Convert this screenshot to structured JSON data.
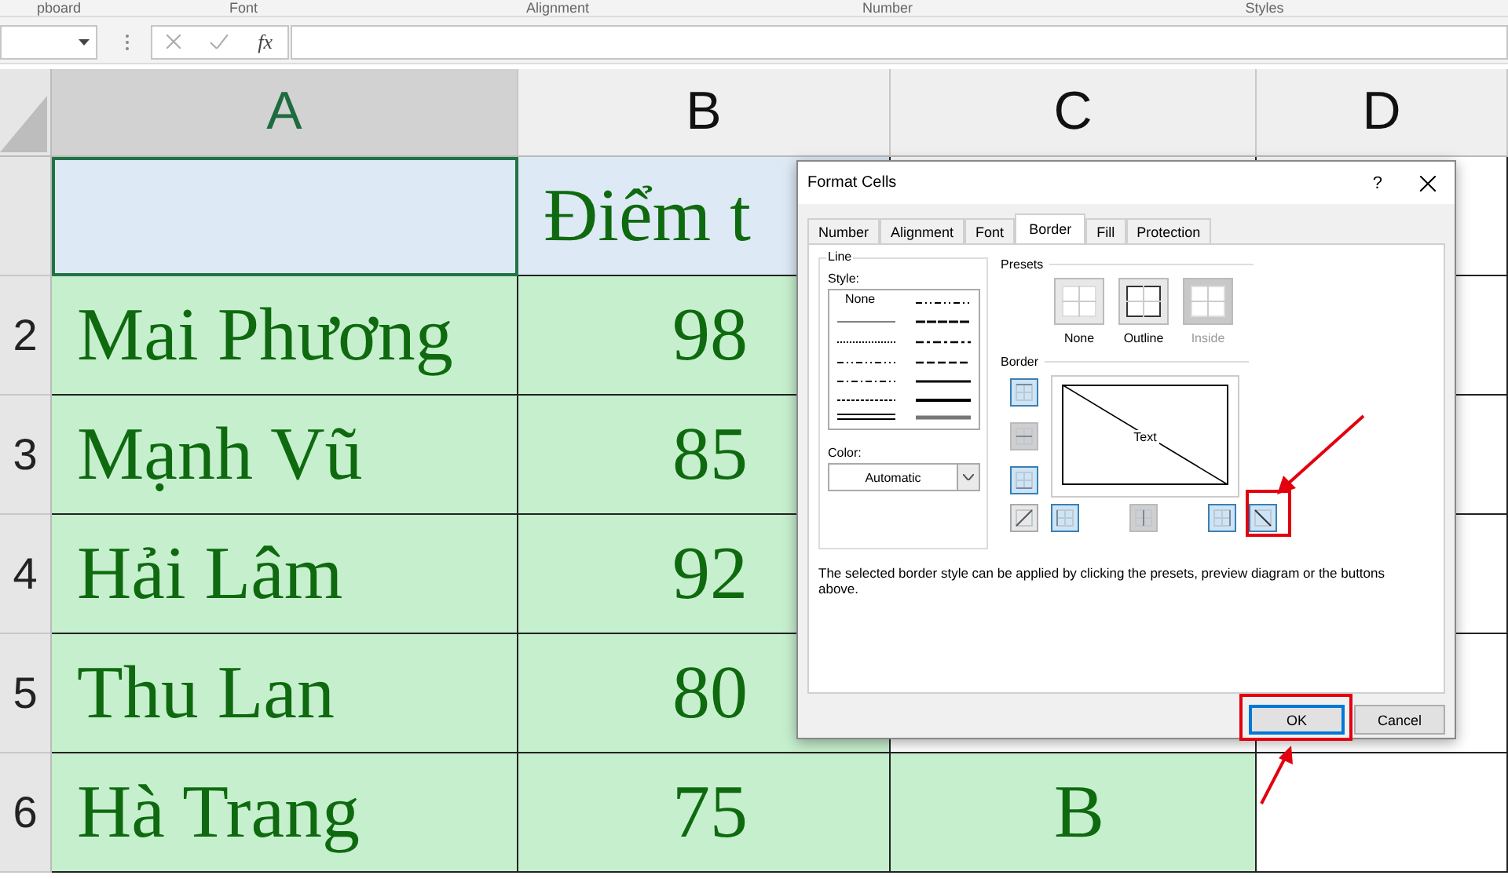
{
  "ribbon_groups": [
    "pboard",
    "Font",
    "Alignment",
    "Number",
    "Styles"
  ],
  "formula_bar": {
    "function_label": "fx"
  },
  "sheet": {
    "columns": [
      {
        "label": "A",
        "selected": true
      },
      {
        "label": "B",
        "selected": false
      },
      {
        "label": "C",
        "selected": false
      },
      {
        "label": "D",
        "selected": false
      }
    ],
    "rows": [
      {
        "cells": [
          {
            "selected": true,
            "color": "#dde9f5"
          },
          {
            "text": "Điểm t",
            "selected": false,
            "color": "#dde9f5"
          },
          {},
          {
            "selected": false
          }
        ]
      },
      {
        "number": "2",
        "cells": [
          {
            "text": "Mai Phương",
            "selected": false,
            "color": "#c6efce"
          },
          {
            "text": "98",
            "selected": false,
            "color": "#c6efce"
          },
          {},
          {
            "selected": false
          }
        ]
      },
      {
        "number": "3",
        "cells": [
          {
            "text": "Mạnh Vũ",
            "selected": false,
            "color": "#c6efce"
          },
          {
            "text": "85",
            "selected": false,
            "color": "#c6efce"
          },
          {},
          {
            "selected": false
          }
        ]
      },
      {
        "number": "4",
        "cells": [
          {
            "text": "Hải Lâm",
            "selected": false,
            "color": "#c6efce"
          },
          {
            "text": "92",
            "selected": false,
            "color": "#c6efce"
          },
          {},
          {
            "selected": false
          }
        ]
      },
      {
        "number": "5",
        "cells": [
          {
            "text": "Thu Lan",
            "selected": false,
            "color": "#c6efce"
          },
          {
            "text": "80",
            "selected": false,
            "color": "#c6efce"
          },
          {},
          {
            "selected": false
          }
        ]
      },
      {
        "number": "6",
        "cells": [
          {
            "text": "Hà Trang",
            "selected": false,
            "color": "#c6efce"
          },
          {
            "text": "75",
            "selected": false,
            "color": "#c6efce"
          },
          {
            "text": "B",
            "selected": false,
            "color": "#c6efce"
          },
          {
            "selected": false
          }
        ]
      }
    ]
  },
  "dialog": {
    "title": "Format Cells",
    "help": "?",
    "tabs": [
      {
        "label": "Number",
        "selected": false
      },
      {
        "label": "Alignment",
        "selected": false
      },
      {
        "label": "Font",
        "selected": false
      },
      {
        "label": "Border",
        "selected": true
      },
      {
        "label": "Fill",
        "selected": false
      },
      {
        "label": "Protection",
        "selected": false
      }
    ],
    "line_group": {
      "title": "Line",
      "style_label": "Style:",
      "none_option": "None",
      "color_label": "Color:",
      "color_value": "Automatic"
    },
    "presets_label": "Presets",
    "presets": [
      {
        "label": "None",
        "disabled": false
      },
      {
        "label": "Outline",
        "disabled": false
      },
      {
        "label": "Inside",
        "disabled": true
      }
    ],
    "border_label": "Border",
    "preview_text": "Text",
    "side_buttons": [
      {
        "kind": "top",
        "on": true,
        "disabled": false
      },
      {
        "kind": "middle",
        "disabled": true
      },
      {
        "kind": "bottom",
        "on": true,
        "disabled": false
      }
    ],
    "bottom_buttons": [
      {
        "kind": "diagonal-up",
        "on": false,
        "disabled": false
      },
      {
        "kind": "left",
        "on": true,
        "disabled": false
      },
      {
        "kind": "center",
        "disabled": true
      },
      {
        "kind": "right",
        "on": true,
        "disabled": false
      },
      {
        "kind": "diagonal-down",
        "on": true,
        "disabled": false
      }
    ],
    "hint": "The selected border style can be applied by clicking the presets, preview diagram or the buttons above.",
    "buttons": [
      {
        "label": "OK",
        "selected": true
      },
      {
        "label": "Cancel",
        "selected": false
      }
    ]
  }
}
